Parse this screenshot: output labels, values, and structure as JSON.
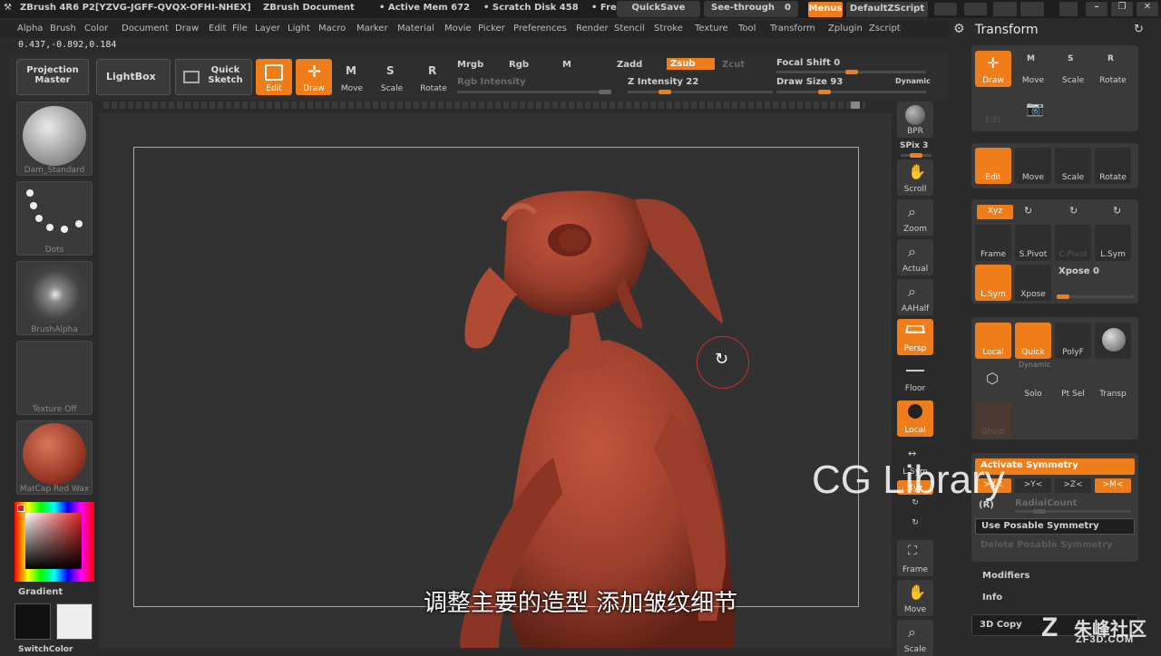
{
  "title_bar": {
    "app": "ZBrush 4R6 P2[YZVG-JGFF-QVQX-OFHI-NHEX]",
    "document": "ZBrush Document",
    "active_mem": "• Active Mem 672",
    "scratch_disk": "• Scratch Disk 458",
    "free": "• Fre",
    "quicksave": "QuickSave",
    "see_through": "See-through",
    "see_through_value": "0",
    "menus": "Menus",
    "default_zscript": "DefaultZScript"
  },
  "menu": [
    "Alpha",
    "Brush",
    "Color",
    "Document",
    "Draw",
    "Edit",
    "File",
    "Layer",
    "Light",
    "Macro",
    "Marker",
    "Material",
    "Movie",
    "Picker",
    "Preferences",
    "Render",
    "Stencil",
    "Stroke",
    "Texture",
    "Tool",
    "Transform",
    "Zplugin",
    "Zscript"
  ],
  "coords": "0.437,-0.892,0.184",
  "toolbar": {
    "projection_master": "Projection Master",
    "lightbox": "LightBox",
    "quick_sketch": "Quick Sketch",
    "edit": "Edit",
    "draw": "Draw",
    "move": "Move",
    "scale": "Scale",
    "rotate": "Rotate",
    "mrgb": "Mrgb",
    "rgb": "Rgb",
    "m": "M",
    "zadd": "Zadd",
    "zsub": "Zsub",
    "zcut": "Zcut",
    "rgb_intensity": "Rgb Intensity",
    "z_intensity": "Z Intensity 22",
    "focal_shift": "Focal Shift 0",
    "draw_size": "Draw Size 93",
    "dynamic": "Dynamic"
  },
  "left": {
    "brush": "Dam_Standard",
    "stroke": "Dots",
    "alpha": "BrushAlpha",
    "texture": "Texture Off",
    "material": "MatCap Red Wax",
    "gradient": "Gradient",
    "switch_color": "SwitchColor"
  },
  "right_shelf": {
    "bpr": "BPR",
    "spix": "SPix 3",
    "scroll": "Scroll",
    "zoom": "Zoom",
    "actual": "Actual",
    "aahalf": "AAHalf",
    "persp": "Persp",
    "floor": "Floor",
    "local": "Local",
    "lsym": "L.Sym",
    "xyz": "Xyz",
    "frame": "Frame",
    "move": "Move",
    "scale": "Scale"
  },
  "panel": {
    "title": "Transform",
    "row1": [
      "Draw",
      "Move",
      "Scale",
      "Rotate"
    ],
    "edit_label": "Edit",
    "row2": [
      "Edit",
      "Move",
      "Scale",
      "Rotate"
    ],
    "xyz": "Xyz",
    "row3": [
      "Frame",
      "S.Pivot",
      "C.Pivot",
      "L.Sym"
    ],
    "lsym": "L.Sym",
    "xpose_btn": "Xpose",
    "xpose": "Xpose 0",
    "row5": [
      "Local",
      "Quick",
      "PolyF"
    ],
    "dynamic": "Dynamic",
    "row6": [
      "Solo",
      "Pt Sel",
      "Transp"
    ],
    "ghost": "Ghost",
    "activate_symmetry": "Activate Symmetry",
    "sym_x": ">X<",
    "sym_y": ">Y<",
    "sym_z": ">Z<",
    "sym_m": ">M<",
    "radial_r": "(R)",
    "radial_count": "RadialCount",
    "use_posable": "Use Posable Symmetry",
    "delete_posable": "Delete Posable Symmetry",
    "modifiers": "Modifiers",
    "info": "Info",
    "copy3d": "3D Copy"
  },
  "subtitle": "调整主要的造型 添加皱纹细节",
  "watermark": "CG Library",
  "logo_text": "朱峰社区",
  "logo_url": "ZF3D.COM",
  "colors": {
    "accent": "#ef7d1a",
    "model": "#a0442f"
  }
}
